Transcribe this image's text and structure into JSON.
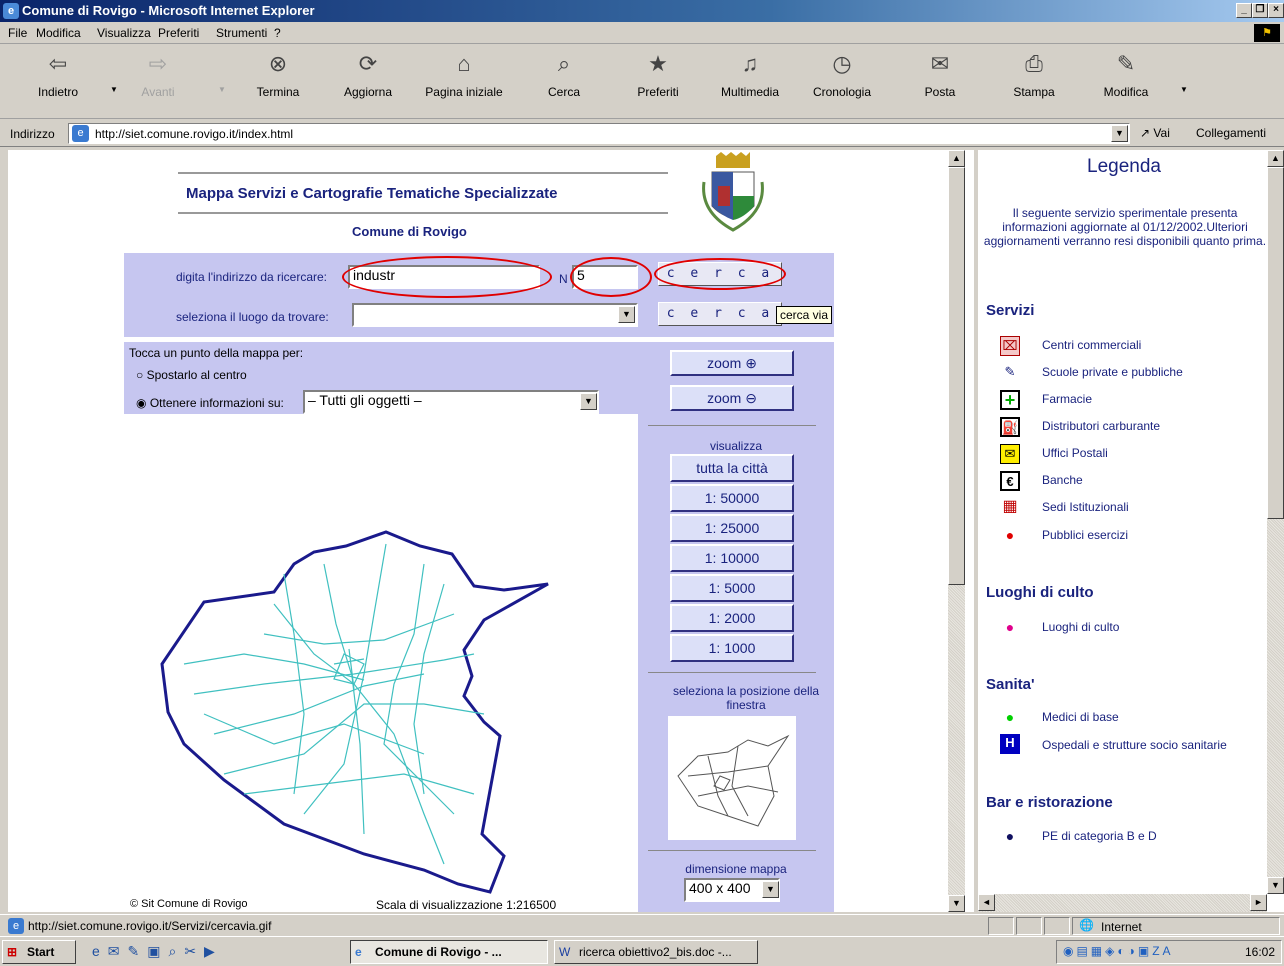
{
  "window": {
    "title": "Comune di Rovigo - Microsoft Internet Explorer"
  },
  "menu": [
    "File",
    "Modifica",
    "Visualizza",
    "Preferiti",
    "Strumenti",
    "?"
  ],
  "toolbar": [
    {
      "label": "Indietro",
      "icon": "back-arrow-icon"
    },
    {
      "label": "Avanti",
      "icon": "forward-arrow-icon"
    },
    {
      "label": "Termina",
      "icon": "stop-icon"
    },
    {
      "label": "Aggiorna",
      "icon": "refresh-icon"
    },
    {
      "label": "Pagina iniziale",
      "icon": "home-icon"
    },
    {
      "label": "Cerca",
      "icon": "search-icon"
    },
    {
      "label": "Preferiti",
      "icon": "favorites-icon"
    },
    {
      "label": "Multimedia",
      "icon": "media-icon"
    },
    {
      "label": "Cronologia",
      "icon": "history-icon"
    },
    {
      "label": "Posta",
      "icon": "mail-icon"
    },
    {
      "label": "Stampa",
      "icon": "print-icon"
    },
    {
      "label": "Modifica",
      "icon": "edit-icon"
    }
  ],
  "address": {
    "label": "Indirizzo",
    "url": "http://siet.comune.rovigo.it/index.html",
    "go": "Vai",
    "links": "Collegamenti"
  },
  "page": {
    "title": "Mappa Servizi e Cartografie Tematiche Specializzate",
    "subtitle": "Comune di Rovigo",
    "search": {
      "address_label": "digita l'indirizzo da ricercare:",
      "address_value": "industr",
      "number_label": "N",
      "number_value": "5",
      "cerca": "c e r c a",
      "place_label": "seleziona il luogo da trovare:",
      "place_value": "",
      "tooltip": "cerca via"
    },
    "map_controls": {
      "intro": "Tocca un punto della mappa per:",
      "option_center": "Spostarlo al centro",
      "option_info": "Ottenere informazioni su:",
      "info_select": "– Tutti gli oggetti –",
      "selected_option": "Ottenere informazioni su:"
    },
    "zoom_in": "zoom",
    "zoom_out": "zoom",
    "visualizza": "visualizza",
    "scales": [
      "tutta la città",
      "1: 50000",
      "1: 25000",
      "1: 10000",
      "1: 5000",
      "1: 2000",
      "1: 1000"
    ],
    "position_label": "seleziona la posizione della finestra",
    "dimension_label": "dimensione mappa",
    "dimension_value": "400 x 400",
    "copyright": "© Sit Comune di Rovigo",
    "scale_text": "Scala di visualizzazione 1:216500"
  },
  "legend": {
    "title": "Legenda",
    "intro": "Il seguente servizio sperimentale presenta informazioni aggiornate al 01/12/2002.Ulteriori aggiornamenti verranno resi disponibili quanto prima.",
    "sections": [
      {
        "name": "Servizi",
        "items": [
          {
            "label": "Centri commerciali",
            "icon": "shopping-icon"
          },
          {
            "label": "Scuole private e pubbliche",
            "icon": "school-icon"
          },
          {
            "label": "Farmacie",
            "icon": "pharmacy-cross-icon"
          },
          {
            "label": "Distributori carburante",
            "icon": "fuel-pump-icon"
          },
          {
            "label": "Uffici Postali",
            "icon": "envelope-icon"
          },
          {
            "label": "Banche",
            "icon": "euro-icon"
          },
          {
            "label": "Sedi Istituzionali",
            "icon": "building-icon"
          },
          {
            "label": "Pubblici esercizi",
            "icon": "red-dot-icon"
          }
        ]
      },
      {
        "name": "Luoghi di culto",
        "items": [
          {
            "label": "Luoghi di culto",
            "icon": "magenta-dot-icon"
          }
        ]
      },
      {
        "name": "Sanita'",
        "items": [
          {
            "label": "Medici di base",
            "icon": "green-dot-icon"
          },
          {
            "label": "Ospedali e strutture socio sanitarie",
            "icon": "hospital-h-icon"
          }
        ]
      },
      {
        "name": "Bar e ristorazione",
        "items": [
          {
            "label": "PE di categoria B e D",
            "icon": "navy-dot-icon"
          }
        ]
      }
    ]
  },
  "status": {
    "text": "http://siet.comune.rovigo.it/Servizi/cercavia.gif",
    "zone": "Internet"
  },
  "taskbar": {
    "start": "Start",
    "tasks": [
      "Comune di Rovigo - ...",
      "ricerca obiettivo2_bis.doc -..."
    ],
    "clock": "16:02"
  },
  "colors": {
    "accent": "#1a237e",
    "panel": "#c6c6f0",
    "map_boundary": "#1a1a8c",
    "map_roads": "#40c0c0",
    "highlight": "#e00000"
  }
}
